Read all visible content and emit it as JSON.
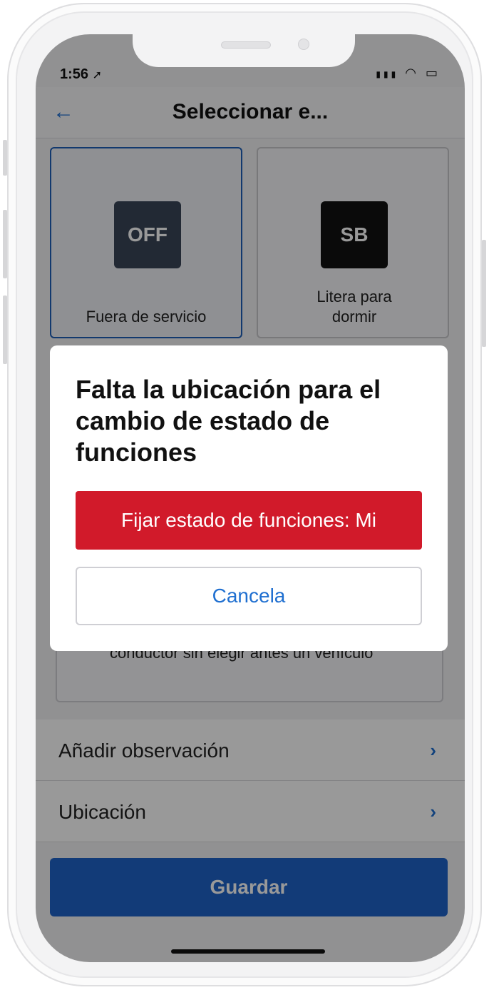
{
  "status_bar": {
    "time": "1:56",
    "location_icon": "location-arrow-icon",
    "icons": "signal-icon wifi-icon battery-icon"
  },
  "header": {
    "title": "Seleccionar e...",
    "back_icon": "back-arrow-icon"
  },
  "status_cards": [
    {
      "code": "OFF",
      "label": "Fuera de servicio",
      "selected": true,
      "color": "#3a4558"
    },
    {
      "code": "SB",
      "label": "Litera para dormir",
      "selected": false,
      "color": "#111111"
    }
  ],
  "vehicle_notice": {
    "text": "conductor sin elegir antes un vehículo"
  },
  "rows": [
    {
      "label": "Añadir observación",
      "chevron": "›"
    },
    {
      "label": "Ubicación",
      "chevron": "›"
    }
  ],
  "save": {
    "label": "Guardar"
  },
  "dialog": {
    "title": "Falta la ubicación para el cambio de estado de funciones",
    "confirm_label": "Fijar estado de funciones: Mi",
    "cancel_label": "Cancela"
  },
  "colors": {
    "primary": "#1f63c9",
    "danger": "#d11a2a",
    "link": "#1f6fd0"
  }
}
